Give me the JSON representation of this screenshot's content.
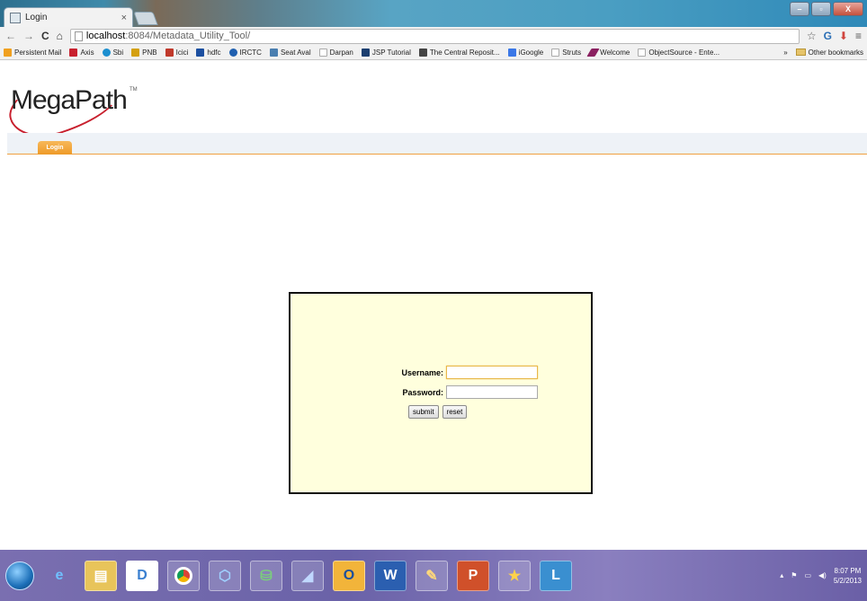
{
  "browser": {
    "tab_title": "Login",
    "tab_close": "×",
    "address_host": "localhost",
    "address_path": ":8084/Metadata_Utility_Tool/",
    "window_buttons": [
      "–",
      "▫",
      "X"
    ]
  },
  "bookmarks": [
    {
      "label": "Persistent Mail",
      "color": "#f0a020"
    },
    {
      "label": "Axis",
      "color": "#c8202e"
    },
    {
      "label": "Sbi",
      "color": "#1c8fd0"
    },
    {
      "label": "PNB",
      "color": "#d4a010"
    },
    {
      "label": "Icici",
      "color": "#c0392b"
    },
    {
      "label": "hdfc",
      "color": "#1c4fa0"
    },
    {
      "label": "IRCTC",
      "color": "#2060b0"
    },
    {
      "label": "Seat Aval",
      "color": "#4a7fb0"
    },
    {
      "label": "Darpan",
      "color": "#aaaaaa"
    },
    {
      "label": "JSP Tutorial",
      "color": "#1c3f70"
    },
    {
      "label": "The Central Reposit...",
      "color": "#444444"
    },
    {
      "label": "iGoogle",
      "color": "#3b78e7"
    },
    {
      "label": "Struts",
      "color": "#aaaaaa"
    },
    {
      "label": "Welcome",
      "color": "#8a2060"
    },
    {
      "label": "ObjectSource - Ente...",
      "color": "#aaaaaa"
    }
  ],
  "bookmarks_more": "»",
  "bookmarks_other": "Other bookmarks",
  "logo": {
    "text": "MegaPath",
    "tm": "TM"
  },
  "menu": {
    "login_tab": "Login"
  },
  "form": {
    "username_label": "Username:",
    "username_value": "",
    "password_label": "Password:",
    "password_value": "",
    "submit_label": "submit",
    "reset_label": "reset"
  },
  "taskbar": {
    "time": "8:07 PM",
    "date": "5/2/2013",
    "apps": [
      "IE",
      "Explorer",
      "D",
      "Chrome",
      "VirtualBox",
      "DB",
      "Eclipse",
      "Outlook",
      "Word",
      "Paint",
      "PowerPoint",
      "Star",
      "Lync"
    ]
  }
}
